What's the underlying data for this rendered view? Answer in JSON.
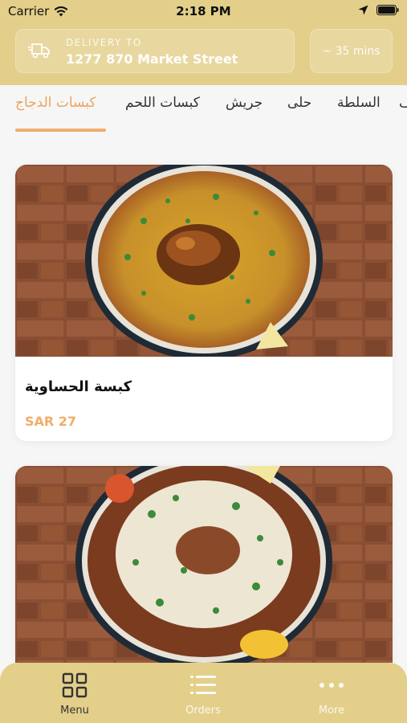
{
  "status_bar": {
    "carrier": "Carrier",
    "time": "2:18 PM"
  },
  "header": {
    "delivery_label": "DELIVERY TO",
    "address": "1277 870 Market Street",
    "eta": "~ 35 mins"
  },
  "categories": [
    {
      "label": "كبسات الدجاج",
      "active": true
    },
    {
      "label": "كبسات اللحم",
      "active": false
    },
    {
      "label": "جريش",
      "active": false
    },
    {
      "label": "حلى",
      "active": false
    },
    {
      "label": "السلطة",
      "active": false
    },
    {
      "label": "ف",
      "active": false
    }
  ],
  "menu_items": [
    {
      "name": "كبسة الحساوية",
      "price": "SAR 27"
    },
    {
      "name": "",
      "price": ""
    }
  ],
  "tab_bar": [
    {
      "label": "Menu",
      "icon": "grid-icon",
      "active": true
    },
    {
      "label": "Orders",
      "icon": "list-icon",
      "active": false
    },
    {
      "label": "More",
      "icon": "dots-icon",
      "active": false
    }
  ],
  "colors": {
    "header_bg": "#e3cf8a",
    "accent": "#f0ad6a",
    "tabbar_bg": "#e3cf8a"
  }
}
